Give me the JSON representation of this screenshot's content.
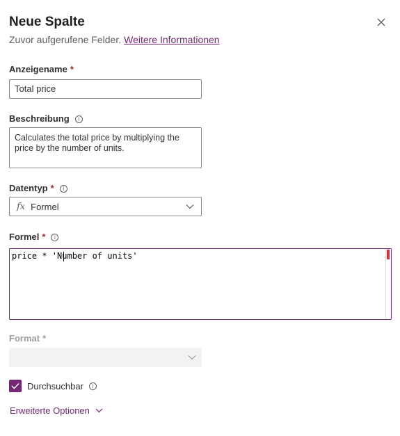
{
  "panel": {
    "title": "Neue Spalte",
    "subtitle": "Zuvor aufgerufene Felder.",
    "more_info_link": "Weitere Informationen"
  },
  "display_name": {
    "label": "Anzeigename",
    "required": "*",
    "value": "Total price"
  },
  "description": {
    "label": "Beschreibung",
    "value": "Calculates the total price by multiplying the price by the number of units."
  },
  "data_type": {
    "label": "Datentyp",
    "required": "*",
    "icon_text": "fx",
    "value": "Formel"
  },
  "formula": {
    "label": "Formel",
    "required": "*",
    "value": "price * 'Number of units'"
  },
  "format": {
    "label": "Format",
    "required": "*",
    "value": ""
  },
  "searchable": {
    "label": "Durchsuchbar",
    "checked": true
  },
  "advanced_options": {
    "label": "Erweiterte Optionen"
  },
  "colors": {
    "accent": "#742774",
    "required": "#a4262c",
    "error_marker": "#d13438"
  },
  "icons": {
    "close": "close-icon",
    "info": "info-icon",
    "chevron": "chevron-down-icon",
    "check": "checkmark-icon"
  }
}
